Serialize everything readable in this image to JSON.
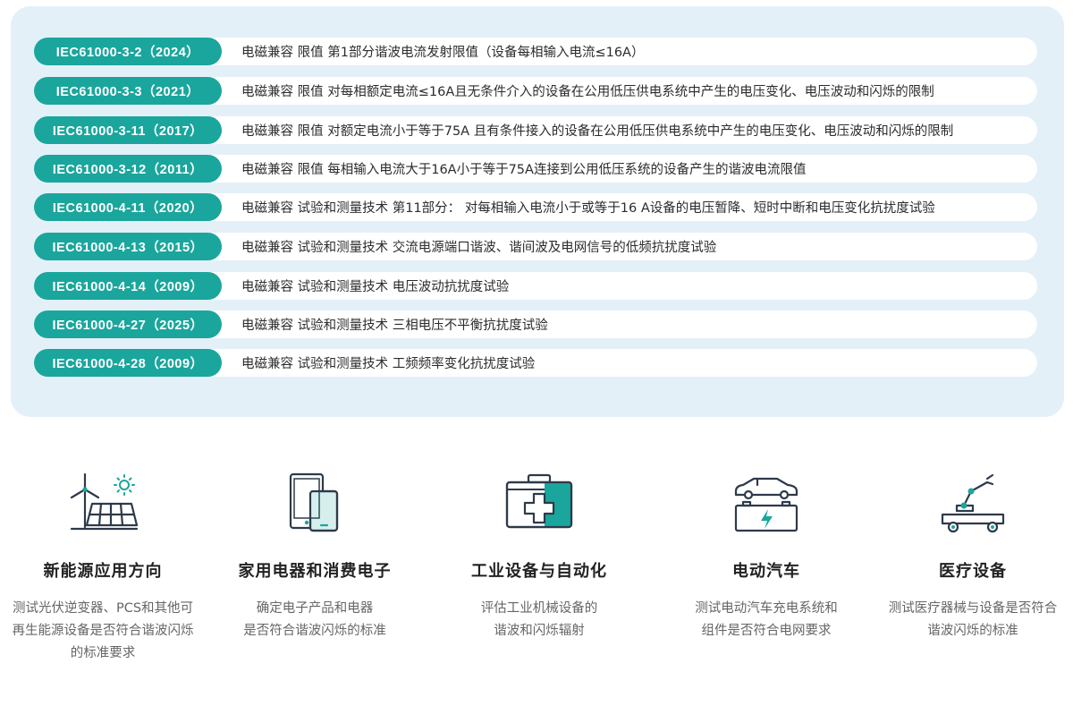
{
  "standards": [
    {
      "code": "IEC61000-3-2（2024）",
      "desc": "电磁兼容 限值 第1部分谐波电流发射限值（设备每相输入电流≤16A）"
    },
    {
      "code": "IEC61000-3-3（2021）",
      "desc": "电磁兼容 限值 对每相额定电流≤16A且无条件介入的设备在公用低压供电系统中产生的电压变化、电压波动和闪烁的限制"
    },
    {
      "code": "IEC61000-3-11（2017）",
      "desc": "电磁兼容 限值 对额定电流小于等于75A 且有条件接入的设备在公用低压供电系统中产生的电压变化、电压波动和闪烁的限制"
    },
    {
      "code": "IEC61000-3-12（2011）",
      "desc": "电磁兼容 限值 每相输入电流大于16A小于等于75A连接到公用低压系统的设备产生的谐波电流限值"
    },
    {
      "code": "IEC61000-4-11（2020）",
      "desc": "电磁兼容 试验和测量技术 第11部分：  对每相输入电流小于或等于16 A设备的电压暂降、短时中断和电压变化抗扰度试验"
    },
    {
      "code": "IEC61000-4-13（2015）",
      "desc": "电磁兼容 试验和测量技术 交流电源端口谐波、谐间波及电网信号的低频抗扰度试验"
    },
    {
      "code": "IEC61000-4-14（2009）",
      "desc": "电磁兼容 试验和测量技术 电压波动抗扰度试验"
    },
    {
      "code": "IEC61000-4-27（2025）",
      "desc": "电磁兼容 试验和测量技术 三相电压不平衡抗扰度试验"
    },
    {
      "code": "IEC61000-4-28（2009）",
      "desc": "电磁兼容 试验和测量技术 工频频率变化抗扰度试验"
    }
  ],
  "features": [
    {
      "icon": "solar-wind-icon",
      "title": "新能源应用方向",
      "lines": [
        "测试光伏逆变器、PCS和其他可",
        "再生能源设备是否符合谐波闪烁",
        "的标准要求"
      ]
    },
    {
      "icon": "phone-tablet-icon",
      "title": "家用电器和消费电子",
      "lines": [
        "确定电子产品和电器",
        "是否符合谐波闪烁的标准"
      ]
    },
    {
      "icon": "toolbox-icon",
      "title": "工业设备与自动化",
      "lines": [
        "评估工业机械设备的",
        "谐波和闪烁辐射"
      ]
    },
    {
      "icon": "car-battery-icon",
      "title": "电动汽车",
      "lines": [
        "测试电动汽车充电系统和",
        "组件是否符合电网要求"
      ]
    },
    {
      "icon": "medical-robot-icon",
      "title": "医疗设备",
      "lines": [
        "测试医疗器械与设备是否符合",
        "谐波闪烁的标准"
      ]
    }
  ],
  "colors": {
    "accent": "#1aa69d",
    "panel_bg": "#e4f0f8",
    "icon_dark": "#2d3a4a"
  }
}
